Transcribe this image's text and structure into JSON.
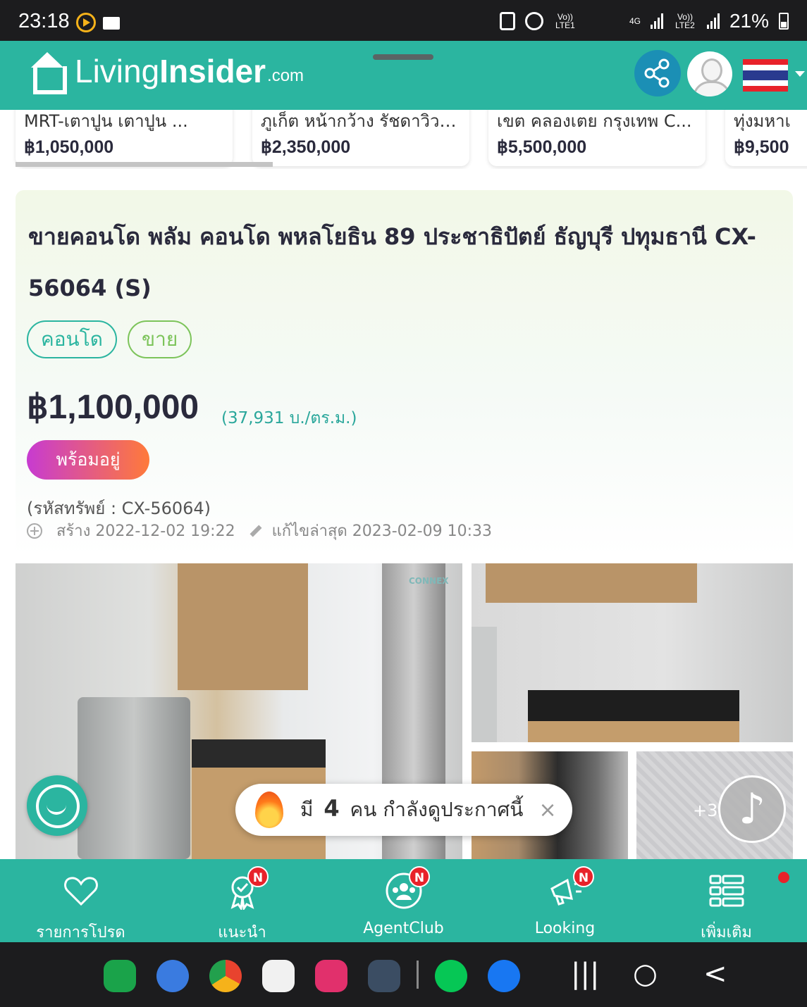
{
  "status_bar": {
    "time": "23:18",
    "net_1": "Vo)) LTE1",
    "net_4g": "4G",
    "net_2": "Vo)) LTE2",
    "battery": "21%"
  },
  "header": {
    "brand_living": "Living",
    "brand_insider": "Insider",
    "brand_com": ".com",
    "share_icon": "share-icon",
    "avatar_icon": "user-avatar",
    "flag_icon": "thailand-flag"
  },
  "cards": [
    {
      "title": "MRT-เตาปูน เตาปูน ...",
      "price": "฿1,050,000"
    },
    {
      "title": "ภูเก็ต หน้ากว้าง รัชดาวิวท...",
      "price": "฿2,350,000"
    },
    {
      "title": "เขต คลองเตย กรุงเทพ C...",
      "price": "฿5,500,000"
    },
    {
      "title": "ทุ่งมหาเ",
      "price": "฿9,500"
    }
  ],
  "listing": {
    "title": "ขายคอนโด พลัม คอนโด พหลโยธิน 89 ประชาธิปัตย์ ธัญบุรี ปทุมธานี CX-56064 (S)",
    "tag_type": "คอนโด",
    "tag_deal": "ขาย",
    "price": "฿1,100,000",
    "price_per_sqm": "(37,931 บ./ตร.ม.)",
    "status": "พร้อมอยู่",
    "code": "(รหัสทรัพย์ : CX-56064)",
    "created": "สร้าง 2022-12-02 19:22",
    "updated": "แก้ไขล่าสุด 2023-02-09 10:33",
    "more_photos": "+3",
    "watermark": "CONNEX"
  },
  "viewers": {
    "prefix": "มี",
    "count": "4",
    "suffix": "คน กำลังดูประกาศนี้",
    "close": "×"
  },
  "bottom_nav": [
    {
      "label": "รายการโปรด",
      "icon": "heart-icon",
      "badge": ""
    },
    {
      "label": "แนะนำ",
      "icon": "award-icon",
      "badge": "N"
    },
    {
      "label": "AgentClub",
      "icon": "agent-club-icon",
      "badge": "N"
    },
    {
      "label": "Looking",
      "icon": "megaphone-icon",
      "badge": "N"
    },
    {
      "label": "เพิ่มเติม",
      "icon": "menu-grid-icon",
      "badge": ""
    }
  ],
  "system_nav": {
    "recents": "|||",
    "home": "○",
    "back": "<"
  },
  "colors": {
    "brand_teal": "#2bb5a0",
    "badge_red": "#e8222a",
    "status_gradient_start": "#c73bd1",
    "status_gradient_end": "#ff7a3a"
  }
}
